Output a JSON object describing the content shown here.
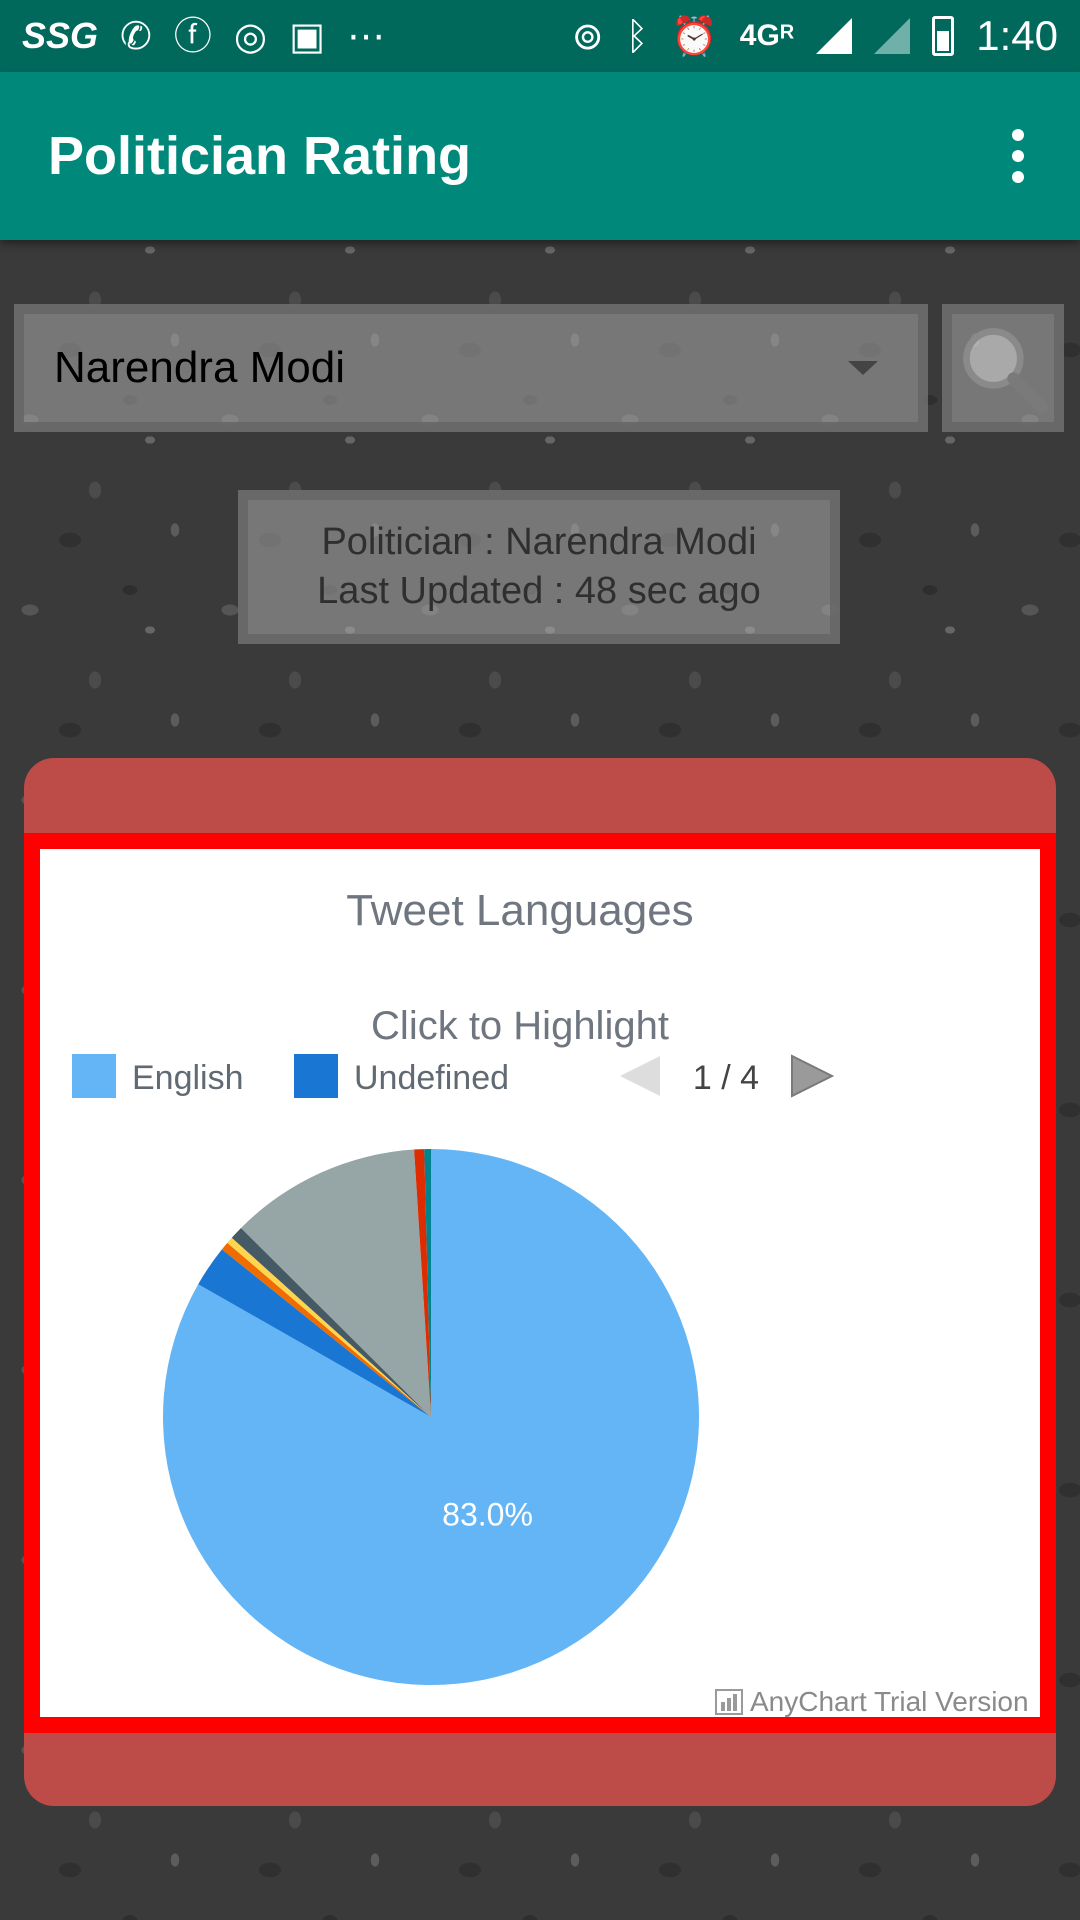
{
  "status_bar": {
    "carrier": "SSG",
    "network": "4G",
    "roaming": "R",
    "time": "1:40",
    "icons": [
      "whatsapp-icon",
      "facebook-icon",
      "circle-app-icon",
      "calendar-icon",
      "more-icon",
      "hotspot-icon",
      "bluetooth-icon",
      "alarm-icon",
      "signal-icon",
      "battery-icon"
    ]
  },
  "app_bar": {
    "title": "Politician Rating"
  },
  "search": {
    "selected_politician": "Narendra Modi"
  },
  "info": {
    "politician_line": "Politician : Narendra Modi",
    "updated_line": "Last Updated : 48 sec ago"
  },
  "colors": {
    "status_bar": "#00695c",
    "app_bar": "#00897b",
    "card": "#bd4c48",
    "chart_border": "#ff0000"
  },
  "chart_data": {
    "type": "pie",
    "title": "Tweet Languages",
    "subtitle": "Click to Highlight",
    "legend": {
      "placement": "top",
      "entries": [
        "English",
        "Undefined"
      ],
      "page": "1 / 4"
    },
    "slices": [
      {
        "name": "English",
        "value": 83.0,
        "color": "#64b5f6",
        "label": "83.0%"
      },
      {
        "name": "Undefined",
        "value": 2.5,
        "color": "#1976d2"
      },
      {
        "name": "",
        "value": 0.5,
        "color": "#ef6c00"
      },
      {
        "name": "",
        "value": 0.4,
        "color": "#ffd54f"
      },
      {
        "name": "",
        "value": 0.8,
        "color": "#455a64"
      },
      {
        "name": "",
        "value": 11.5,
        "color": "#96a6a6"
      },
      {
        "name": "",
        "value": 0.6,
        "color": "#dd2c00"
      },
      {
        "name": "",
        "value": 0.4,
        "color": "#00838f"
      }
    ],
    "credit": "AnyChart Trial Version"
  }
}
